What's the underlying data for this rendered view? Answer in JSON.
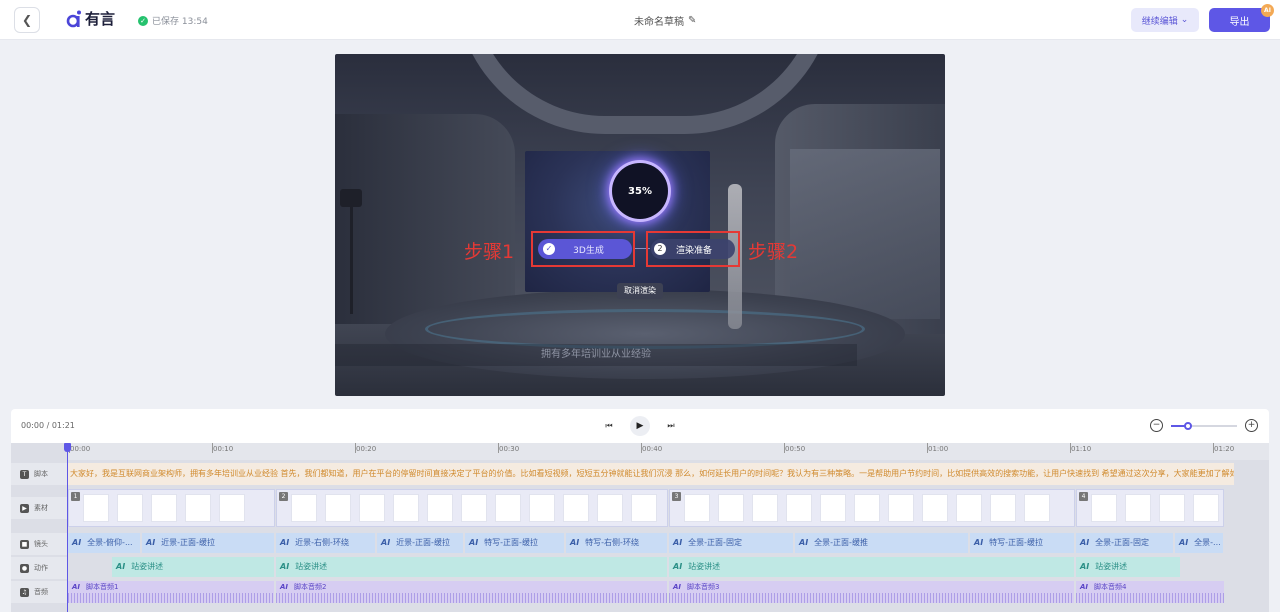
{
  "header": {
    "back_icon": "chevron-left-icon",
    "logo_text": "有言",
    "save_status": "已保存 13:54",
    "doc_title": "未命名草稿",
    "continue_edit": "继续编辑",
    "export": "导出",
    "ai_badge": "AI",
    "accent": "#5e57e6"
  },
  "preview": {
    "caption": "拥有多年培训业从业经验",
    "progress_text": "35%",
    "progress": 0.35,
    "step1_label": "3D生成",
    "step2_num": "2",
    "step2_label": "渲染准备",
    "cancel_render": "取消渲染",
    "annotation1": "步骤1",
    "annotation2": "步骤2",
    "annotation_color": "#e53935"
  },
  "controls": {
    "time": "00:00 / 01:21",
    "zoom_level": 0.25
  },
  "ruler": [
    "00:00",
    "00:10",
    "00:20",
    "00:30",
    "00:40",
    "00:50",
    "01:00",
    "01:10",
    "01:20"
  ],
  "tracks": {
    "labels": [
      "脚本",
      "素材",
      "镜头",
      "动作",
      "音频"
    ],
    "script_text": "大家好，我是互联网商业架构师，拥有多年培训业从业经验 首先，我们都知道，用户在平台的停留时间直接决定了平台的价值。比如看短视频，短短五分钟就能让我们沉浸 那么，如何延长用户的时间呢？我认为有三种策略。一是帮助用户节约时间，比如提供高效的搜索功能，让用户快速找到 希望通过这次分享，大家能更加了解如何保",
    "material_badges": [
      "1",
      "2",
      "3",
      "4"
    ],
    "camera": [
      {
        "ai": "AI",
        "label": "全景-俯仰-..."
      },
      {
        "ai": "AI",
        "label": "近景-正面-缓拉"
      },
      {
        "ai": "AI",
        "label": "近景-右侧-环绕"
      },
      {
        "ai": "AI",
        "label": "近景-正面-缓拉"
      },
      {
        "ai": "AI",
        "label": "特写-正面-缓拉"
      },
      {
        "ai": "AI",
        "label": "特写-右侧-环绕"
      },
      {
        "ai": "AI",
        "label": "全景-正面-固定"
      },
      {
        "ai": "AI",
        "label": "全景-正面-缓推"
      },
      {
        "ai": "AI",
        "label": "特写-正面-缓拉"
      },
      {
        "ai": "AI",
        "label": "全景-正面-固定"
      },
      {
        "ai": "AI",
        "label": "全景-..."
      }
    ],
    "action": [
      {
        "ai": "AI",
        "label": "站姿讲述"
      },
      {
        "ai": "AI",
        "label": "站姿讲述"
      },
      {
        "ai": "AI",
        "label": "站姿讲述"
      },
      {
        "ai": "AI",
        "label": "站姿讲述"
      }
    ],
    "audio": [
      {
        "ai": "AI",
        "label": "脚本音频1"
      },
      {
        "ai": "AI",
        "label": "脚本音频2"
      },
      {
        "ai": "AI",
        "label": "脚本音频3"
      },
      {
        "ai": "AI",
        "label": "脚本音频4"
      }
    ]
  }
}
